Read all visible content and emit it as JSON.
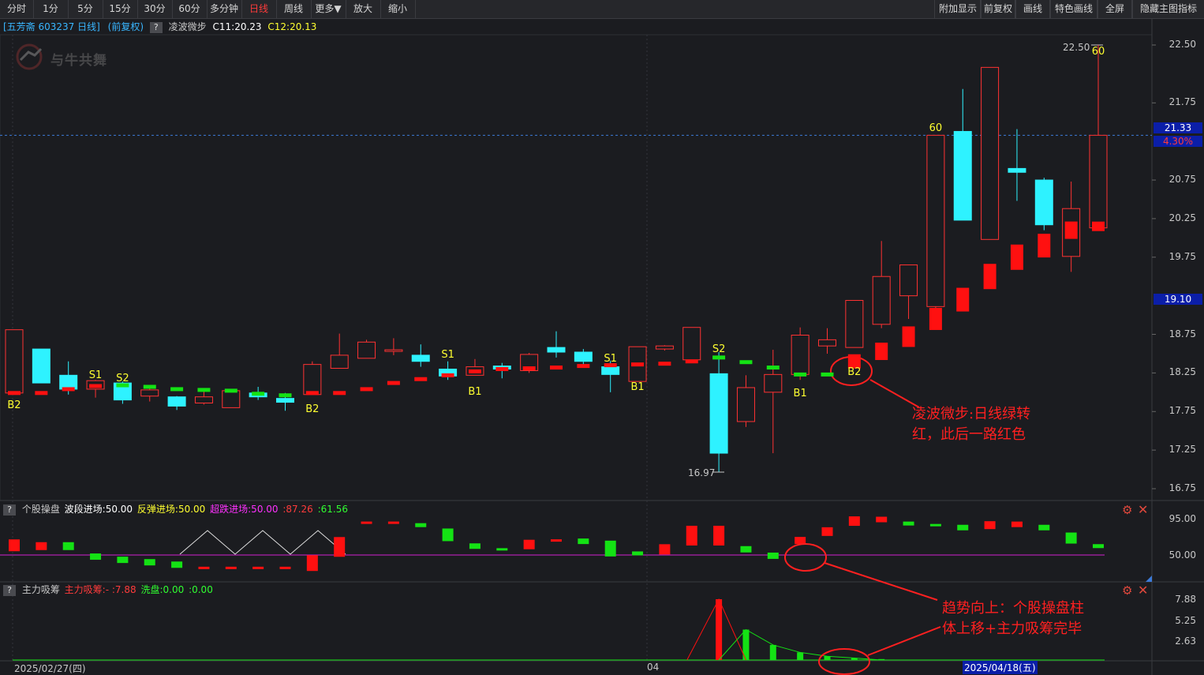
{
  "toolbar": {
    "left": [
      "分时",
      "1分",
      "5分",
      "15分",
      "30分",
      "60分",
      "多分钟",
      "日线",
      "周线",
      "更多▼",
      "放大",
      "缩小"
    ],
    "active": "日线",
    "right": [
      "附加显示",
      "前复权",
      "画线",
      "特色画线",
      "全屏",
      "隐藏主图指标"
    ]
  },
  "info": {
    "stock": "[五芳斋 603237 日线]",
    "adj": "(前复权)",
    "help": "?",
    "indicator": "凌波微步",
    "c1": "C11:20.23",
    "c2": "C12:20.13"
  },
  "logo_text": "与牛共舞",
  "main_axis": {
    "ticks": [
      "22.50",
      "21.75",
      "20.75",
      "20.25",
      "19.75",
      "18.75",
      "18.25",
      "17.75",
      "17.25",
      "16.75"
    ],
    "price_tag": "21.33",
    "pct_tag": "4.30%",
    "low_tag": "19.10",
    "high_label": "22.50",
    "low_label": "16.97"
  },
  "signals": [
    "B2",
    "S1",
    "S2",
    "B2",
    "S1",
    "B1",
    "S1",
    "B1",
    "S2",
    "B1",
    "B2",
    "60",
    "60"
  ],
  "panel2": {
    "help": "?",
    "name": "个股操盘",
    "f1": "波段进场:50.00",
    "f2": "反弹进场:50.00",
    "f3": "超跌进场:50.00",
    "f4": ":87.26",
    "f5": ":61.56",
    "ticks": [
      "95.00",
      "50.00"
    ]
  },
  "panel3": {
    "help": "?",
    "name": "主力吸筹",
    "f1": "主力吸筹:-",
    "f2": ":7.88",
    "f3": "洗盘:0.00",
    "f4": ":0.00",
    "ticks": [
      "7.88",
      "5.25",
      "2.63"
    ]
  },
  "dates": {
    "start": "2025/02/27(四)",
    "mid": "04",
    "sel": "2025/04/18(五)"
  },
  "annotations": {
    "a1_line1": "凌波微步:日线绿转",
    "a1_line2": "红，此后一路红色",
    "a2_line1": "趋势向上：个股操盘柱",
    "a2_line2": "体上移+主力吸筹完毕"
  },
  "colors": {
    "up": "#ff3232",
    "down": "#2ef2ff",
    "bg": "#1b1c20",
    "accent": "#ff3b3b"
  },
  "chart_data": {
    "type": "candlestick",
    "ylim": [
      16.6,
      22.7
    ],
    "candles": [
      [
        17.99,
        18.81,
        17.99,
        18.81
      ],
      [
        18.56,
        18.12,
        18.12,
        18.56
      ],
      [
        18.22,
        18.04,
        17.97,
        18.4
      ],
      [
        18.04,
        18.15,
        17.93,
        18.16
      ],
      [
        18.12,
        17.9,
        17.85,
        18.14
      ],
      [
        17.95,
        18.03,
        17.88,
        18.05
      ],
      [
        17.94,
        17.82,
        17.77,
        17.95
      ],
      [
        17.86,
        17.94,
        17.84,
        18.04
      ],
      [
        17.8,
        18.02,
        17.8,
        18.02
      ],
      [
        17.99,
        17.94,
        17.9,
        18.07
      ],
      [
        17.92,
        17.87,
        17.76,
        17.99
      ],
      [
        17.97,
        18.36,
        17.97,
        18.4
      ],
      [
        18.31,
        18.48,
        18.31,
        18.76
      ],
      [
        18.44,
        18.65,
        18.44,
        18.68
      ],
      [
        18.55,
        18.55,
        18.48,
        18.7
      ],
      [
        18.48,
        18.4,
        18.33,
        18.62
      ],
      [
        18.3,
        18.21,
        18.16,
        18.4
      ],
      [
        18.22,
        18.33,
        18.22,
        18.43
      ],
      [
        18.34,
        18.3,
        18.18,
        18.38
      ],
      [
        18.28,
        18.49,
        18.25,
        18.51
      ],
      [
        18.58,
        18.52,
        18.45,
        18.79
      ],
      [
        18.52,
        18.4,
        18.36,
        18.56
      ],
      [
        18.33,
        18.23,
        18.0,
        18.41
      ],
      [
        18.14,
        18.59,
        18.14,
        18.59
      ],
      [
        18.56,
        18.6,
        18.54,
        18.61
      ],
      [
        18.42,
        18.84,
        18.38,
        18.84
      ],
      [
        18.24,
        17.21,
        16.97,
        18.52
      ],
      [
        17.62,
        18.06,
        17.55,
        18.22
      ],
      [
        18.0,
        18.23,
        17.21,
        18.55
      ],
      [
        18.23,
        18.74,
        18.16,
        18.84
      ],
      [
        18.6,
        18.68,
        18.5,
        18.83
      ],
      [
        18.58,
        19.19,
        18.58,
        19.19
      ],
      [
        18.88,
        19.5,
        18.83,
        19.96
      ],
      [
        19.25,
        19.65,
        18.95,
        19.65
      ],
      [
        19.11,
        21.33,
        18.9,
        21.33
      ],
      [
        21.38,
        20.23,
        20.23,
        21.93
      ],
      [
        19.98,
        22.21,
        19.98,
        22.21
      ],
      [
        20.9,
        20.85,
        20.48,
        21.41
      ],
      [
        20.75,
        20.17,
        20.1,
        20.78
      ],
      [
        19.76,
        20.38,
        19.56,
        20.73
      ],
      [
        20.13,
        21.33,
        20.13,
        22.5
      ]
    ]
  }
}
